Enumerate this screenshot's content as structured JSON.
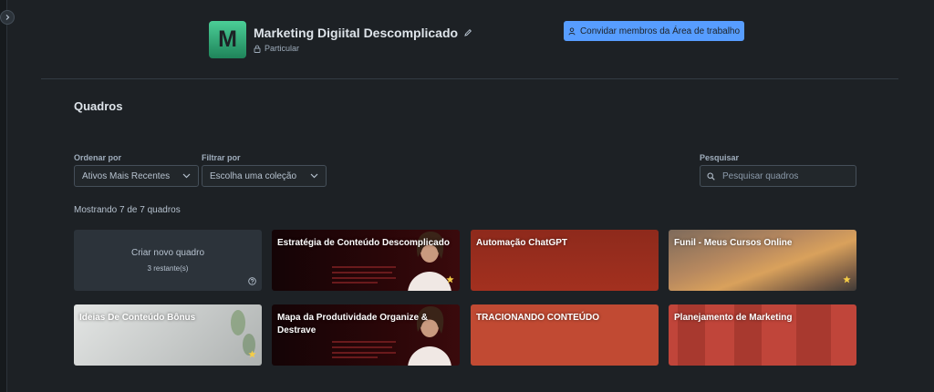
{
  "workspace": {
    "logo_letter": "M",
    "title": "Marketing Digiital Descomplicado",
    "visibility": "Particular",
    "invite_label": "Convidar membros da Área de trabalho"
  },
  "boards_section": {
    "title": "Quadros",
    "sort_label": "Ordenar por",
    "sort_value": "Ativos Mais Recentes",
    "filter_label": "Filtrar por",
    "filter_value": "Escolha uma coleção",
    "search_label": "Pesquisar",
    "search_placeholder": "Pesquisar quadros",
    "count_text": "Mostrando 7 de 7 quadros"
  },
  "create_tile": {
    "title": "Criar novo quadro",
    "remaining": "3 restante(s)"
  },
  "boards": [
    {
      "title": "Estratégia de Conteúdo Descomplicado",
      "starred": true,
      "background": "dark-red-promo-image"
    },
    {
      "title": "Automação ChatGPT",
      "starred": false,
      "background": "#9a2d1e"
    },
    {
      "title": "Funil - Meus Cursos Online",
      "starred": true,
      "background": "sunset-coast-image"
    },
    {
      "title": "Ideias De Conteúdo Bônus",
      "starred": true,
      "background": "marble-desk-image"
    },
    {
      "title": "Mapa da Produtividade Organize & Destrave",
      "starred": false,
      "background": "dark-red-promo-image"
    },
    {
      "title": "TRACIONANDO CONTEÚDO",
      "starred": false,
      "background": "#c14a33"
    },
    {
      "title": "Planejamento de Marketing",
      "starred": false,
      "background": "#c0453a"
    }
  ],
  "colors": {
    "background": "#1d2125",
    "accent": "#579dff",
    "star": "#f5cd47"
  },
  "icons": [
    "expand-sidebar-icon",
    "pencil-icon",
    "lock-icon",
    "add-person-icon",
    "chevron-down-icon",
    "search-icon",
    "help-icon",
    "star-icon"
  ]
}
